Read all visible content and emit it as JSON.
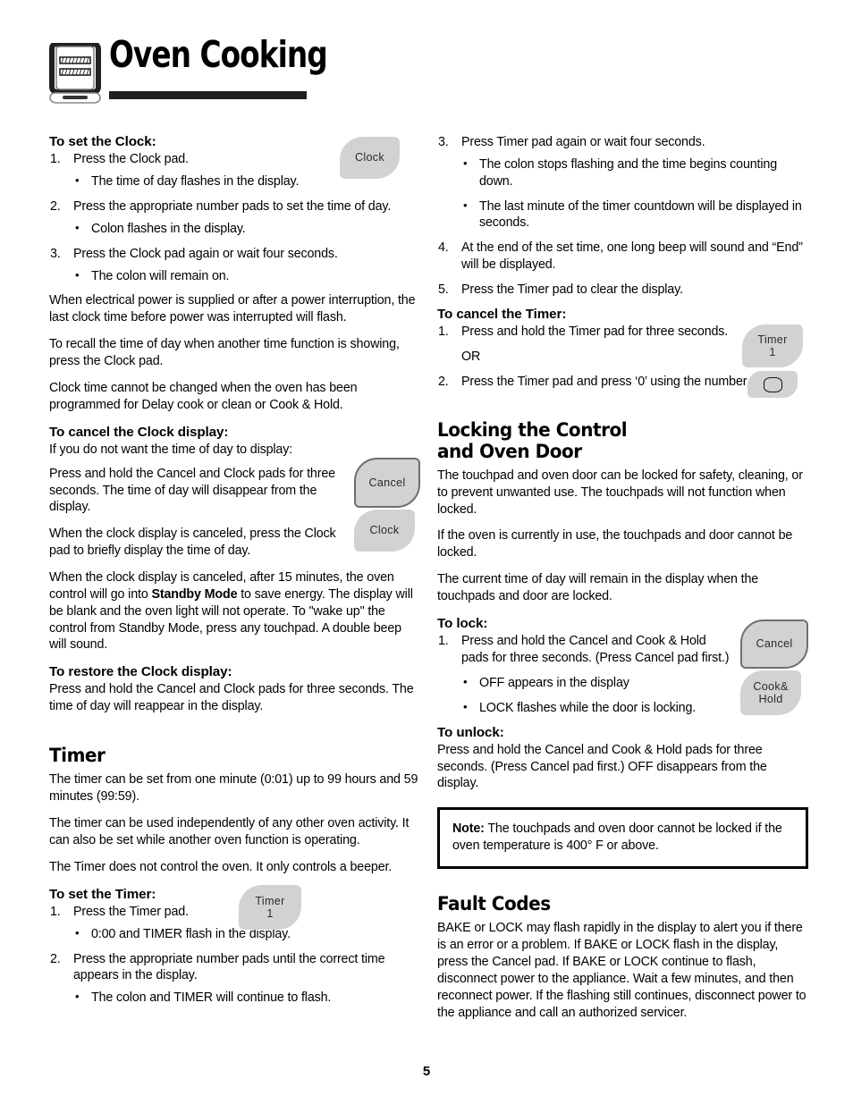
{
  "header": {
    "title": "Oven Cooking",
    "icon": "oven-icon"
  },
  "page_number": "5",
  "left_column": {
    "set_clock": {
      "heading": "To set the Clock:",
      "steps": [
        {
          "num": "1.",
          "text": "Press the Clock pad.",
          "bullets": [
            "The time of day flashes in the display."
          ]
        },
        {
          "num": "2.",
          "text": "Press the appropriate number pads to set the time of day.",
          "bullets": [
            "Colon flashes in the display."
          ]
        },
        {
          "num": "3.",
          "text": "Press the Clock pad again or wait four seconds.",
          "bullets": [
            "The colon will remain on."
          ]
        }
      ],
      "paragraphs": [
        "When electrical power is supplied or after a power interruption, the last clock time before power was interrupted will flash.",
        "To recall the time of day when another time function is showing, press the Clock pad.",
        "Clock time cannot be changed when the oven has been programmed for Delay cook or clean or Cook & Hold."
      ],
      "pad": {
        "label": "Clock"
      }
    },
    "cancel_clock": {
      "heading": "To cancel the Clock display:",
      "intro": "If you do not want the time of day to display:",
      "paragraphs": [
        "Press and hold the Cancel and Clock pads for three seconds. The time of day will disappear from the display.",
        "When the clock display is canceled, press the Clock pad to briefly display the time of day."
      ],
      "standby_part1": "When the clock display is canceled, after 15 minutes, the oven control will go into ",
      "standby_bold": "Standby Mode",
      "standby_part2": " to save energy.  The display will be blank and the oven light will not operate.  To \"wake up\" the control from Standby Mode, press any touchpad.  A double beep will sound.",
      "pads": [
        {
          "label": "Cancel",
          "outlined": true
        },
        {
          "label": "Clock",
          "outlined": false
        }
      ]
    },
    "restore_clock": {
      "heading": "To restore the Clock display:",
      "paragraph": "Press and hold the Cancel and Clock pads for three seconds. The time of day will reappear in the display."
    },
    "timer": {
      "heading": "Timer",
      "paragraphs": [
        "The timer can be set from one minute (0:01) up to 99 hours and 59 minutes (99:59).",
        "The timer can be used independently of any other oven activity.  It can also be set while another oven function is operating.",
        "The Timer does not control the oven.  It only controls a beeper."
      ]
    },
    "set_timer": {
      "heading": "To set the Timer:",
      "steps": [
        {
          "num": "1.",
          "text": "Press the Timer pad.",
          "bullets": [
            "0:00 and TIMER flash in the display."
          ]
        },
        {
          "num": "2.",
          "text": "Press the appropriate number pads until the correct time appears in the display.",
          "bullets": [
            "The colon and TIMER will continue to flash."
          ]
        }
      ],
      "pad": {
        "label": "Timer",
        "sub": "1"
      }
    }
  },
  "right_column": {
    "timer_cont": {
      "steps": [
        {
          "num": "3.",
          "text": "Press Timer pad again or wait four seconds.",
          "bullets": [
            "The colon stops flashing and the time begins counting down.",
            "The last minute of the timer countdown will be displayed in seconds."
          ]
        },
        {
          "num": "4.",
          "text": "At the end of the set time, one long beep will sound and “End” will be displayed.",
          "bullets": []
        },
        {
          "num": "5.",
          "text": "Press the Timer pad to clear the display.",
          "bullets": []
        }
      ]
    },
    "cancel_timer": {
      "heading": "To cancel the Timer:",
      "steps": [
        {
          "num": "1.",
          "text": "Press and hold the Timer pad for three seconds."
        },
        {
          "num": "",
          "text": "OR"
        },
        {
          "num": "2.",
          "text": "Press the Timer pad and press ‘0’ using the number pads."
        }
      ],
      "pads": [
        {
          "label": "Timer",
          "sub": "1"
        },
        {
          "label": "",
          "glyph": "zero-key-glyph"
        }
      ]
    },
    "locking": {
      "heading_line1": "Locking the Control",
      "heading_line2": "and Oven Door",
      "paragraphs": [
        "The touchpad and oven door can be locked for safety, cleaning, or to prevent unwanted use.  The touchpads will not function when locked.",
        "If the oven is currently in use, the touchpads and door cannot be locked.",
        "The current time of day will remain in the display when the touchpads and door are locked."
      ]
    },
    "to_lock": {
      "heading": "To lock:",
      "steps": [
        {
          "num": "1.",
          "text": "Press and hold the Cancel and Cook & Hold pads for three seconds. (Press Cancel pad first.)"
        }
      ],
      "bullets": [
        "OFF appears in the display",
        "LOCK flashes while the door is locking."
      ],
      "pads": [
        {
          "label": "Cancel",
          "outlined": true
        },
        {
          "label": "Cook&",
          "sub": "Hold",
          "outlined": false
        }
      ]
    },
    "to_unlock": {
      "heading": "To unlock:",
      "paragraph": "Press and hold the Cancel and Cook & Hold pads for three seconds. (Press Cancel pad first.) OFF disappears from the display."
    },
    "note": {
      "label": "Note:",
      "text": " The touchpads and oven door cannot be locked if the oven temperature is 400° F or above."
    },
    "fault_codes": {
      "heading": "Fault Codes",
      "paragraph": "BAKE or LOCK may flash rapidly in the display to alert you if there is an error or a problem.  If BAKE or LOCK flash in the display, press the Cancel pad.  If BAKE or LOCK continue to flash, disconnect power to the appliance.  Wait a few minutes, and then reconnect power. If the flashing still continues, disconnect power to the appliance and call an authorized servicer."
    }
  },
  "colors": {
    "pad_fill": "#d2d2d2",
    "pad_stroke": "#6e6e6e",
    "rule": "#231f20",
    "text": "#000000"
  }
}
